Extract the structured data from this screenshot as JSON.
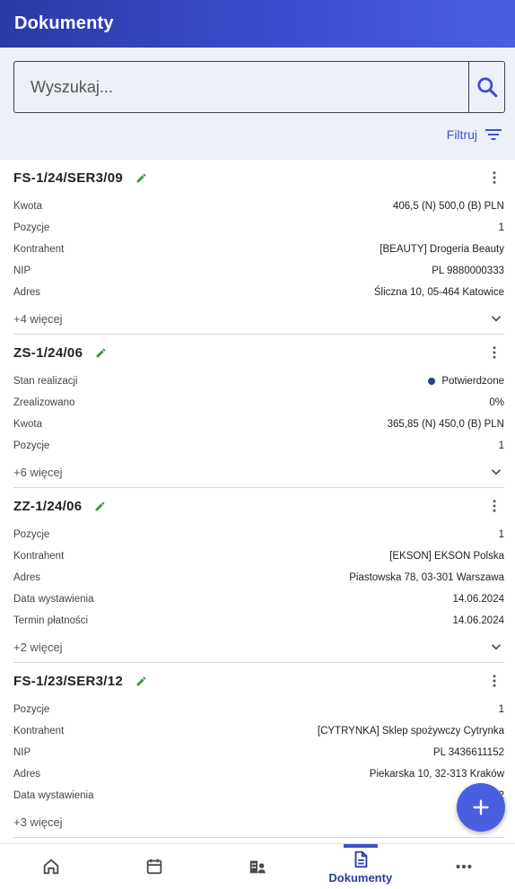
{
  "header": {
    "title": "Dokumenty"
  },
  "search": {
    "placeholder": "Wyszukaj...",
    "icon": "search-icon"
  },
  "filter": {
    "label": "Filtruj",
    "icon": "filter-icon"
  },
  "documents": [
    {
      "number": "FS-1/24/SER3/09",
      "rows": [
        {
          "key": "Kwota",
          "value": "406,5 (N) 500,0 (B) PLN"
        },
        {
          "key": "Pozycje",
          "value": "1"
        },
        {
          "key": "Kontrahent",
          "value": "[BEAUTY] Drogeria Beauty"
        },
        {
          "key": "NIP",
          "value": "PL 9880000333"
        },
        {
          "key": "Adres",
          "value": "Śliczna 10, 05-464 Katowice"
        }
      ],
      "more": "+4 więcej"
    },
    {
      "number": "ZS-1/24/06",
      "rows": [
        {
          "key": "Stan realizacji",
          "value": "Potwierdzone"
        },
        {
          "key": "Zrealizowano",
          "value": "0%"
        },
        {
          "key": "Kwota",
          "value": "365,85 (N) 450,0 (B) PLN"
        },
        {
          "key": "Pozycje",
          "value": "1"
        }
      ],
      "more": "+6 więcej"
    },
    {
      "number": "ZZ-1/24/06",
      "rows": [
        {
          "key": "Pozycje",
          "value": "1"
        },
        {
          "key": "Kontrahent",
          "value": "[EKSON] EKSON Polska"
        },
        {
          "key": "Adres",
          "value": "Piastowska 78, 03-301 Warszawa"
        },
        {
          "key": "Data wystawienia",
          "value": "14.06.2024"
        },
        {
          "key": "Termin płatności",
          "value": "14.06.2024"
        }
      ],
      "more": "+2 więcej"
    },
    {
      "number": "FS-1/23/SER3/12",
      "rows": [
        {
          "key": "Pozycje",
          "value": "1"
        },
        {
          "key": "Kontrahent",
          "value": "[CYTRYNKA] Sklep spożywczy Cytrynka"
        },
        {
          "key": "NIP",
          "value": "PL 3436611152"
        },
        {
          "key": "Adres",
          "value": "Piekarska 10, 32-313 Kraków"
        },
        {
          "key": "Data wystawienia",
          "value": "2"
        }
      ],
      "more": "+3 więcej"
    }
  ],
  "fab": {
    "icon": "plus-icon"
  },
  "bottom_nav": [
    {
      "icon": "home-icon",
      "label": ""
    },
    {
      "icon": "calendar-icon",
      "label": ""
    },
    {
      "icon": "contractors-icon",
      "label": ""
    },
    {
      "icon": "document-icon",
      "label": "Dokumenty"
    },
    {
      "icon": "more-horizontal-icon",
      "label": ""
    }
  ],
  "colors": {
    "primary": "#3d4fd1",
    "header_dark": "#2b3aa6",
    "edit": "#2e9d3b",
    "toolbar_bg": "#eef0f7"
  }
}
